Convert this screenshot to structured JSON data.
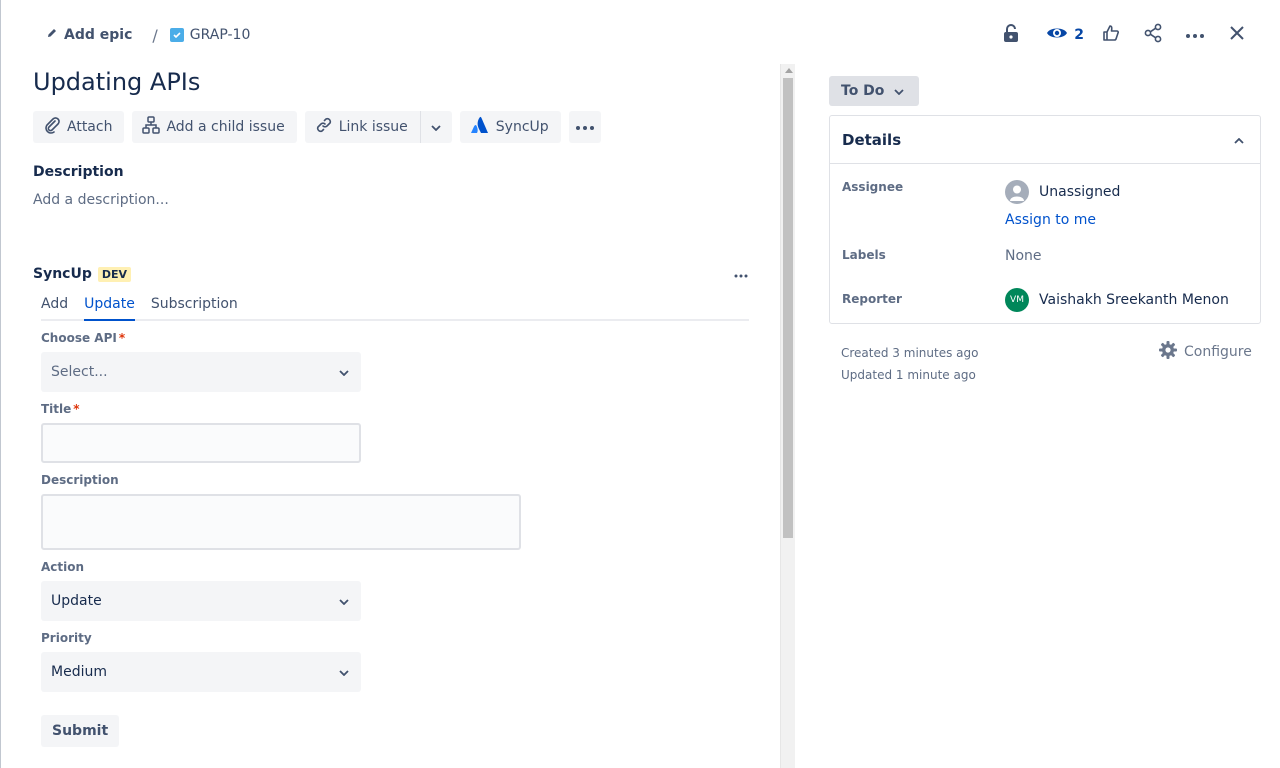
{
  "breadcrumb": {
    "epic_label": "Add epic",
    "separator": "/",
    "issue_key": "GRAP-10"
  },
  "header_actions": {
    "watch_count": "2",
    "icons": [
      "lock-icon",
      "eye-icon",
      "thumbs-up-icon",
      "share-icon",
      "more-icon",
      "close-icon"
    ]
  },
  "issue": {
    "title": "Updating APIs"
  },
  "toolbar": {
    "attach": "Attach",
    "add_child": "Add a child issue",
    "link_issue": "Link issue",
    "syncup": "SyncUp"
  },
  "description": {
    "heading": "Description",
    "placeholder": "Add a description..."
  },
  "syncup": {
    "title": "SyncUp",
    "badge": "DEV",
    "tabs": [
      {
        "label": "Add",
        "active": false
      },
      {
        "label": "Update",
        "active": true
      },
      {
        "label": "Subscription",
        "active": false
      }
    ],
    "form": {
      "choose_api_label": "Choose API",
      "choose_api_value": "Select...",
      "title_label": "Title",
      "description_label": "Description",
      "action_label": "Action",
      "action_value": "Update",
      "priority_label": "Priority",
      "priority_value": "Medium",
      "required_mark": "*",
      "submit": "Submit"
    }
  },
  "status": {
    "label": "To Do"
  },
  "details": {
    "title": "Details",
    "assignee_label": "Assignee",
    "assignee_value": "Unassigned",
    "assign_to_me": "Assign to me",
    "labels_label": "Labels",
    "labels_value": "None",
    "reporter_label": "Reporter",
    "reporter_initials": "VM",
    "reporter_value": "Vaishakh Sreekanth Menon"
  },
  "meta": {
    "created": "Created 3 minutes ago",
    "updated": "Updated 1 minute ago",
    "configure": "Configure"
  },
  "colors": {
    "primary": "#0052cc",
    "text": "#172b4d",
    "subtle": "#5e6c84",
    "dev_badge_bg": "#fff0b3",
    "reporter_avatar": "#00875a",
    "required": "#de350b"
  }
}
